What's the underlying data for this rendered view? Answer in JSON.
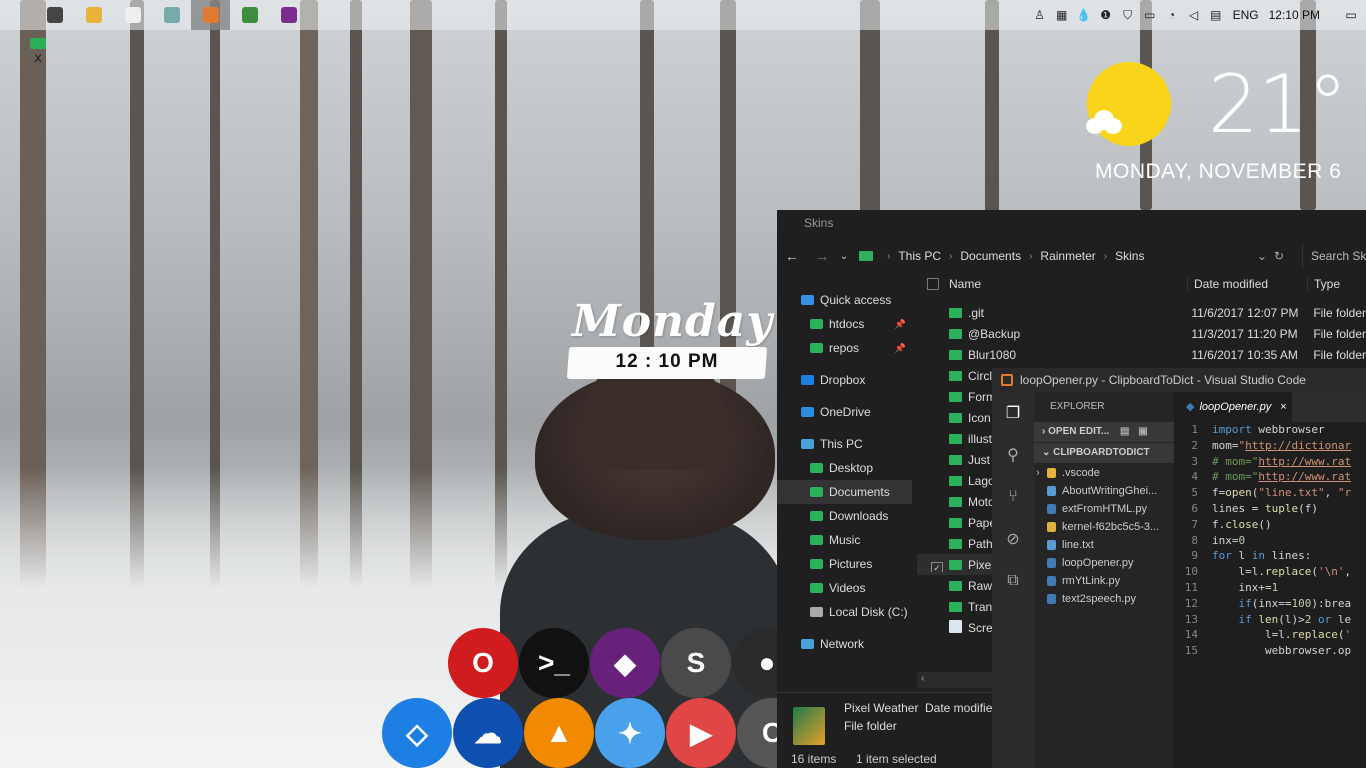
{
  "taskbar": {
    "apps": [
      {
        "name": "task-view",
        "color": "#444"
      },
      {
        "name": "file-explorer",
        "color": "#e7b33a"
      },
      {
        "name": "opera",
        "color": "#eee"
      },
      {
        "name": "network-app",
        "color": "#7aa"
      },
      {
        "name": "sublime",
        "color": "#e07a30"
      },
      {
        "name": "globe-app",
        "color": "#3c8d3c"
      },
      {
        "name": "purple-app",
        "color": "#7b2d8e"
      }
    ],
    "active_index": 4,
    "tray_icons": [
      "people-icon",
      "badge-icon",
      "drop-icon",
      "one-icon",
      "shield-icon",
      "battery-icon",
      "wifi-icon",
      "volume-icon",
      "keyboard-icon"
    ],
    "language": "ENG",
    "clock": "12:10 PM"
  },
  "desktop": {
    "icon_label": "X"
  },
  "weather": {
    "temperature": "21°",
    "date": "MONDAY, NOVEMBER 6",
    "sun_color": "#f8d51a"
  },
  "day_widget": {
    "day": "Monday",
    "time": "12 : 10  PM"
  },
  "dock": {
    "row1": [
      {
        "name": "opera-dock",
        "color": "#d01c1f",
        "glyph": "O"
      },
      {
        "name": "terminal-dock",
        "color": "#111111",
        "glyph": ">_"
      },
      {
        "name": "visual-studio-dock",
        "color": "#68217a",
        "glyph": "◆"
      },
      {
        "name": "sublime-dock",
        "color": "#4a4a4a",
        "glyph": "S"
      },
      {
        "name": "github-dock",
        "color": "#2b2b2b",
        "glyph": "●"
      }
    ],
    "row2": [
      {
        "name": "dropbox-dock",
        "color": "#1d7fe3",
        "glyph": "◇"
      },
      {
        "name": "onedrive-dock",
        "color": "#0f4fb0",
        "glyph": "☁"
      },
      {
        "name": "vlc-dock",
        "color": "#f18a00",
        "glyph": "▲"
      },
      {
        "name": "twitter-dock",
        "color": "#4aa1eb",
        "glyph": "✦"
      },
      {
        "name": "youtube-dock",
        "color": "#e04646",
        "glyph": "▶"
      },
      {
        "name": "ccleaner-dock",
        "color": "#555555",
        "glyph": "C"
      }
    ]
  },
  "explorer": {
    "title": "Skins",
    "breadcrumbs": [
      "This PC",
      "Documents",
      "Rainmeter",
      "Skins"
    ],
    "search_placeholder": "Search Skin",
    "nav": [
      {
        "label": "Quick access",
        "indent": 24,
        "icon": "star-icon",
        "color": "#3a8ee6"
      },
      {
        "label": "htdocs",
        "indent": 33,
        "icon": "folder-icon",
        "color": "#2bb15b",
        "pinned": true
      },
      {
        "label": "repos",
        "indent": 33,
        "icon": "folder-icon",
        "color": "#2bb15b",
        "pinned": true
      },
      {
        "label": "Dropbox",
        "indent": 24,
        "icon": "dropbox-icon",
        "color": "#1d7fe3"
      },
      {
        "label": "OneDrive",
        "indent": 24,
        "icon": "onedrive-icon",
        "color": "#2a8de0"
      },
      {
        "label": "This PC",
        "indent": 24,
        "icon": "pc-icon",
        "color": "#4aa0d8"
      },
      {
        "label": "Desktop",
        "indent": 33,
        "icon": "folder-icon",
        "color": "#2bb15b"
      },
      {
        "label": "Documents",
        "indent": 33,
        "icon": "folder-icon",
        "color": "#2bb15b",
        "selected": true
      },
      {
        "label": "Downloads",
        "indent": 33,
        "icon": "folder-icon",
        "color": "#2bb15b"
      },
      {
        "label": "Music",
        "indent": 33,
        "icon": "folder-icon",
        "color": "#2bb15b"
      },
      {
        "label": "Pictures",
        "indent": 33,
        "icon": "folder-icon",
        "color": "#2bb15b"
      },
      {
        "label": "Videos",
        "indent": 33,
        "icon": "folder-icon",
        "color": "#2bb15b"
      },
      {
        "label": "Local Disk (C:)",
        "indent": 33,
        "icon": "disk-icon",
        "color": "#aaaaaa"
      },
      {
        "label": "Network",
        "indent": 24,
        "icon": "network-icon",
        "color": "#4aa0d8"
      }
    ],
    "columns": {
      "name": "Name",
      "date": "Date modified",
      "type": "Type"
    },
    "rows": [
      {
        "name": ".git",
        "date": "11/6/2017 12:07 PM",
        "type": "File folder"
      },
      {
        "name": "@Backup",
        "date": "11/3/2017 11:20 PM",
        "type": "File folder"
      },
      {
        "name": "Blur1080",
        "date": "11/6/2017 10:35 AM",
        "type": "File folder"
      },
      {
        "name": "Circl",
        "date": "",
        "type": ""
      },
      {
        "name": "Form",
        "date": "",
        "type": ""
      },
      {
        "name": "Icon",
        "date": "",
        "type": ""
      },
      {
        "name": "illust",
        "date": "",
        "type": ""
      },
      {
        "name": "Just",
        "date": "",
        "type": ""
      },
      {
        "name": "Lago",
        "date": "",
        "type": ""
      },
      {
        "name": "Moto",
        "date": "",
        "type": ""
      },
      {
        "name": "Pape",
        "date": "",
        "type": ""
      },
      {
        "name": "Path",
        "date": "",
        "type": ""
      },
      {
        "name": "Pixel",
        "date": "",
        "type": "",
        "selected": true
      },
      {
        "name": "Raw",
        "date": "",
        "type": ""
      },
      {
        "name": "Tran",
        "date": "",
        "type": ""
      },
      {
        "name": "Scre",
        "date": "",
        "type": "",
        "file": true
      }
    ],
    "details": {
      "name": "Pixel Weather",
      "meta": "Date modifie",
      "kind": "File folder"
    },
    "status": {
      "items": "16 items",
      "selected": "1 item selected"
    }
  },
  "vscode": {
    "title": "loopOpener.py - ClipboardToDict - Visual Studio Code",
    "sidebar_title": "EXPLORER",
    "open_editors": "OPEN EDIT...",
    "folder": "CLIPBOARDTODICT",
    "files": [
      {
        "name": ".vscode",
        "color": "#e7b33a",
        "folder": true
      },
      {
        "name": "AboutWritingGhei...",
        "color": "#5a9bd5"
      },
      {
        "name": "extFromHTML.py",
        "color": "#3f7ab5"
      },
      {
        "name": "kernel-f62bc5c5-3...",
        "color": "#e0b040"
      },
      {
        "name": "line.txt",
        "color": "#5a9bd5"
      },
      {
        "name": "loopOpener.py",
        "color": "#3f7ab5"
      },
      {
        "name": "rmYtLink.py",
        "color": "#3f7ab5"
      },
      {
        "name": "text2speech.py",
        "color": "#3f7ab5"
      }
    ],
    "tab": "loopOpener.py",
    "code": [
      {
        "n": "1",
        "html": "<span class='kw'>import</span> webbrowser"
      },
      {
        "n": "2",
        "html": "mom=<span class='st'>\"</span><span class='url'>http://dictionar</span>"
      },
      {
        "n": "3",
        "html": "<span class='cm'># mom=\"</span><span class='url'>http://www.rat</span>"
      },
      {
        "n": "4",
        "html": "<span class='cm'># mom=\"</span><span class='url'>http://www.rat</span>"
      },
      {
        "n": "5",
        "html": "f=<span class='fn'>open</span>(<span class='st'>\"line.txt\"</span>, <span class='st'>\"r</span>"
      },
      {
        "n": "6",
        "html": "lines = <span class='fn'>tuple</span>(f)"
      },
      {
        "n": "7",
        "html": "f.<span class='fn'>close</span>()"
      },
      {
        "n": "8",
        "html": "inx=<span class='nm'>0</span>"
      },
      {
        "n": "9",
        "html": "<span class='kw'>for</span> l <span class='kw'>in</span> lines:"
      },
      {
        "n": "10",
        "html": "    l=l.<span class='fn'>replace</span>(<span class='st'>'\\n'</span>,"
      },
      {
        "n": "11",
        "html": "    inx+=<span class='nm'>1</span>"
      },
      {
        "n": "12",
        "html": "    <span class='kw'>if</span>(inx==<span class='nm'>100</span>):brea"
      },
      {
        "n": "13",
        "html": "    <span class='kw'>if</span> <span class='fn'>len</span>(l)><span class='nm'>2</span> <span class='kw'>or</span> le"
      },
      {
        "n": "14",
        "html": "        l=l.<span class='fn'>replace</span>(<span class='st'>'</span>"
      },
      {
        "n": "15",
        "html": "        webbrowser.op"
      }
    ]
  }
}
